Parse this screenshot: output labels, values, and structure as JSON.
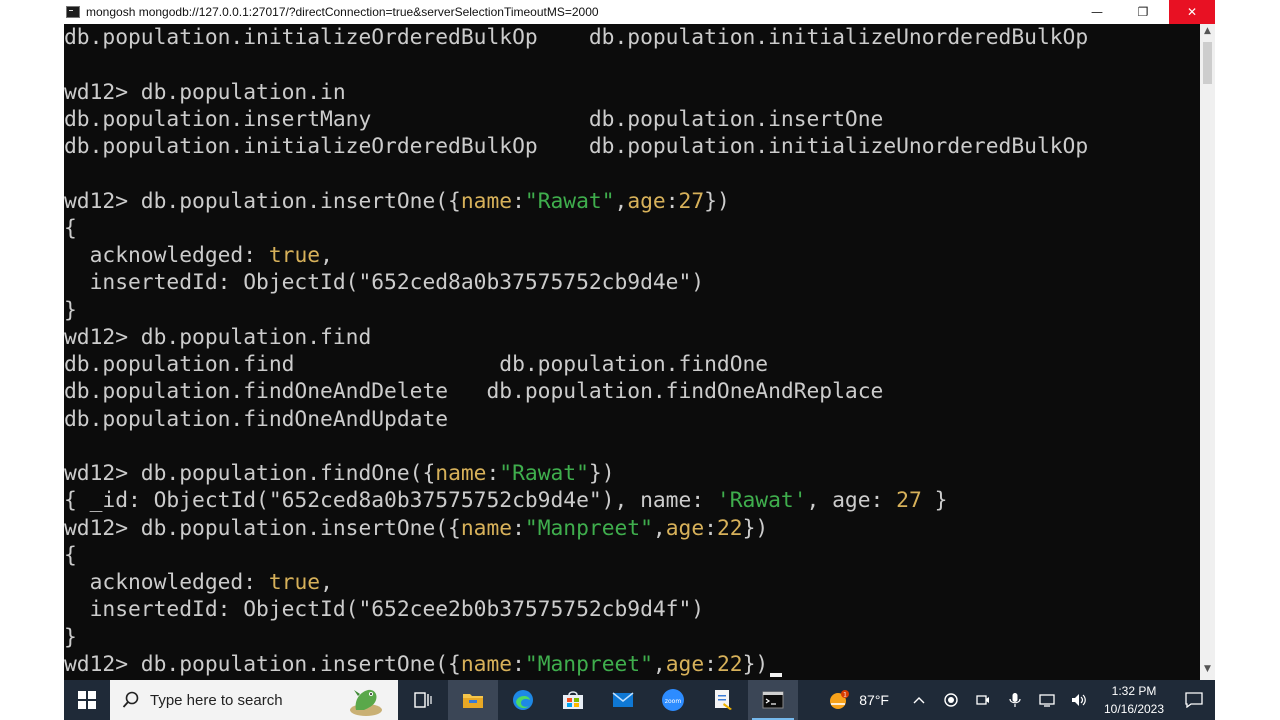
{
  "window": {
    "title": "mongosh mongodb://127.0.0.1:27017/?directConnection=true&serverSelectionTimeoutMS=2000",
    "minimize": "—",
    "maximize": "❐",
    "close": "✕"
  },
  "console": {
    "lines": [
      [
        {
          "t": "db.population.initializeOrderedBulkOp    db.population.initializeUnorderedBulkOp"
        }
      ],
      [
        {
          "t": ""
        }
      ],
      [
        {
          "t": "wd12> db.population.in"
        }
      ],
      [
        {
          "t": "db.population.insertMany                 db.population.insertOne"
        }
      ],
      [
        {
          "t": "db.population.initializeOrderedBulkOp    db.population.initializeUnorderedBulkOp"
        }
      ],
      [
        {
          "t": ""
        }
      ],
      [
        {
          "t": "wd12> db.population.insertOne({"
        },
        {
          "t": "name",
          "c": "y"
        },
        {
          "t": ":"
        },
        {
          "t": "\"Rawat\"",
          "c": "g"
        },
        {
          "t": ","
        },
        {
          "t": "age",
          "c": "y"
        },
        {
          "t": ":"
        },
        {
          "t": "27",
          "c": "y"
        },
        {
          "t": "})"
        }
      ],
      [
        {
          "t": "{"
        }
      ],
      [
        {
          "t": "  acknowledged: "
        },
        {
          "t": "true",
          "c": "y"
        },
        {
          "t": ","
        }
      ],
      [
        {
          "t": "  insertedId: ObjectId(\"652ced8a0b37575752cb9d4e\")"
        }
      ],
      [
        {
          "t": "}"
        }
      ],
      [
        {
          "t": "wd12> db.population.find"
        }
      ],
      [
        {
          "t": "db.population.find                db.population.findOne"
        }
      ],
      [
        {
          "t": "db.population.findOneAndDelete   db.population.findOneAndReplace"
        }
      ],
      [
        {
          "t": "db.population.findOneAndUpdate"
        }
      ],
      [
        {
          "t": ""
        }
      ],
      [
        {
          "t": "wd12> db.population.findOne({"
        },
        {
          "t": "name",
          "c": "y"
        },
        {
          "t": ":"
        },
        {
          "t": "\"Rawat\"",
          "c": "g"
        },
        {
          "t": "})"
        }
      ],
      [
        {
          "t": "{ _id: ObjectId(\"652ced8a0b37575752cb9d4e\"), name: "
        },
        {
          "t": "'Rawat'",
          "c": "g"
        },
        {
          "t": ", age: "
        },
        {
          "t": "27",
          "c": "y"
        },
        {
          "t": " }"
        }
      ],
      [
        {
          "t": "wd12> db.population.insertOne({"
        },
        {
          "t": "name",
          "c": "y"
        },
        {
          "t": ":"
        },
        {
          "t": "\"Manpreet\"",
          "c": "g"
        },
        {
          "t": ","
        },
        {
          "t": "age",
          "c": "y"
        },
        {
          "t": ":"
        },
        {
          "t": "22",
          "c": "y"
        },
        {
          "t": "})"
        }
      ],
      [
        {
          "t": "{"
        }
      ],
      [
        {
          "t": "  acknowledged: "
        },
        {
          "t": "true",
          "c": "y"
        },
        {
          "t": ","
        }
      ],
      [
        {
          "t": "  insertedId: ObjectId(\"652cee2b0b37575752cb9d4f\")"
        }
      ],
      [
        {
          "t": "}"
        }
      ],
      [
        {
          "t": "wd12> db.population.insertOne({"
        },
        {
          "t": "name",
          "c": "y"
        },
        {
          "t": ":"
        },
        {
          "t": "\"Manpreet\"",
          "c": "g"
        },
        {
          "t": ","
        },
        {
          "t": "age",
          "c": "y"
        },
        {
          "t": ":"
        },
        {
          "t": "22",
          "c": "y"
        },
        {
          "t": "})"
        }
      ]
    ]
  },
  "taskbar": {
    "search_placeholder": "Type here to search",
    "weather_temp": "87°F",
    "time": "1:32 PM",
    "date": "10/16/2023",
    "apps": [
      "task-view",
      "file-explorer",
      "edge",
      "microsoft-store",
      "mail",
      "zoom",
      "file-editor",
      "command-prompt"
    ]
  },
  "colors": {
    "console_bg": "#0c0c0c",
    "console_fg": "#cccccc",
    "keyword_yellow": "#d7b15a",
    "string_green": "#3fae4d",
    "taskbar_bg": "#1f2a38"
  }
}
